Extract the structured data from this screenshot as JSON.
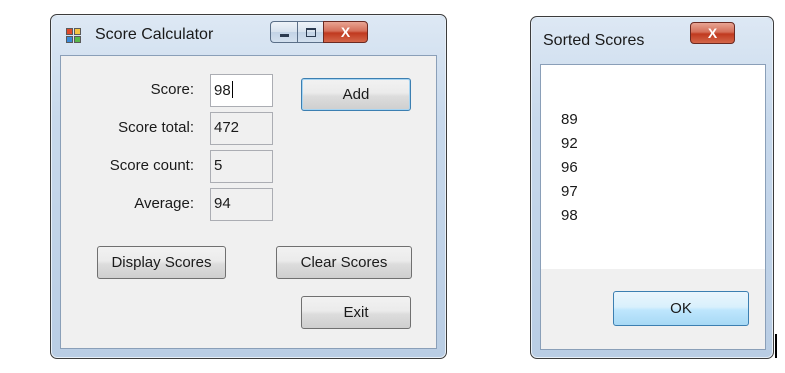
{
  "score_calculator": {
    "title": "Score Calculator",
    "labels": {
      "score": "Score:",
      "score_total": "Score total:",
      "score_count": "Score count:",
      "average": "Average:"
    },
    "values": {
      "score": "98",
      "score_total": "472",
      "score_count": "5",
      "average": "94"
    },
    "buttons": {
      "add": "Add",
      "display_scores": "Display Scores",
      "clear_scores": "Clear Scores",
      "exit": "Exit"
    },
    "caption": {
      "close_glyph": "X"
    }
  },
  "sorted_scores": {
    "title": "Sorted Scores",
    "scores": [
      "89",
      "92",
      "96",
      "97",
      "98"
    ],
    "ok_label": "OK",
    "caption": {
      "close_glyph": "X"
    }
  },
  "icons": [
    "app-icon",
    "minimize-icon",
    "maximize-icon",
    "close-icon"
  ],
  "colors": {
    "window_frame": "#bcd0e6",
    "client_bg": "#f0f0f0",
    "close_button": "#c0391f",
    "focus_border": "#3c7fb1"
  }
}
